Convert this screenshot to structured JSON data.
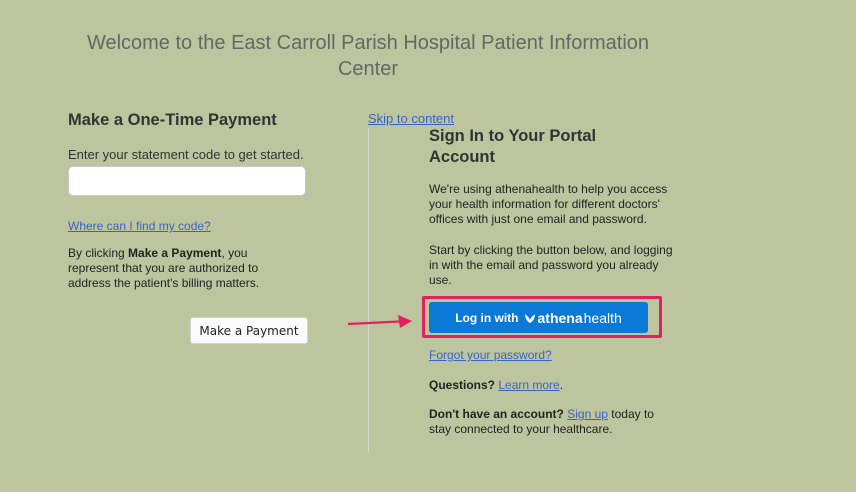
{
  "page": {
    "title": "Welcome to the East Carroll Parish Hospital Patient Information Center"
  },
  "payment": {
    "heading": "Make a One-Time Payment",
    "prompt": "Enter your statement code to get started.",
    "code_input_value": "",
    "find_code_link": "Where can I find my code?",
    "consent_prefix": "By clicking ",
    "consent_bold": "Make a Payment",
    "consent_suffix": ", you represent that you are authorized to address the patient's billing matters.",
    "button_label": "Make a Payment"
  },
  "portal": {
    "skip_link": "Skip to content",
    "heading": "Sign In to Your Portal Account",
    "description": "We're using athenahealth to help you access your health information for different doctors' offices with just one email and password.",
    "description2": "Start by clicking the button below, and logging in with the email and password you already use.",
    "login_button_prefix": "Log in with",
    "login_logo_part1": "athena",
    "login_logo_part2": "health",
    "forgot_link": "Forgot your password?",
    "questions_label": "Questions?",
    "learn_more_link": "Learn more",
    "learn_more_suffix": ".",
    "no_account_label": "Don't have an account?",
    "sign_up_link": "Sign up",
    "no_account_suffix": " today to stay connected to your healthcare."
  },
  "colors": {
    "background": "#bdc59e",
    "link": "#3b63c4",
    "athena_button": "#0a7ad6",
    "highlight": "#e0215f"
  }
}
